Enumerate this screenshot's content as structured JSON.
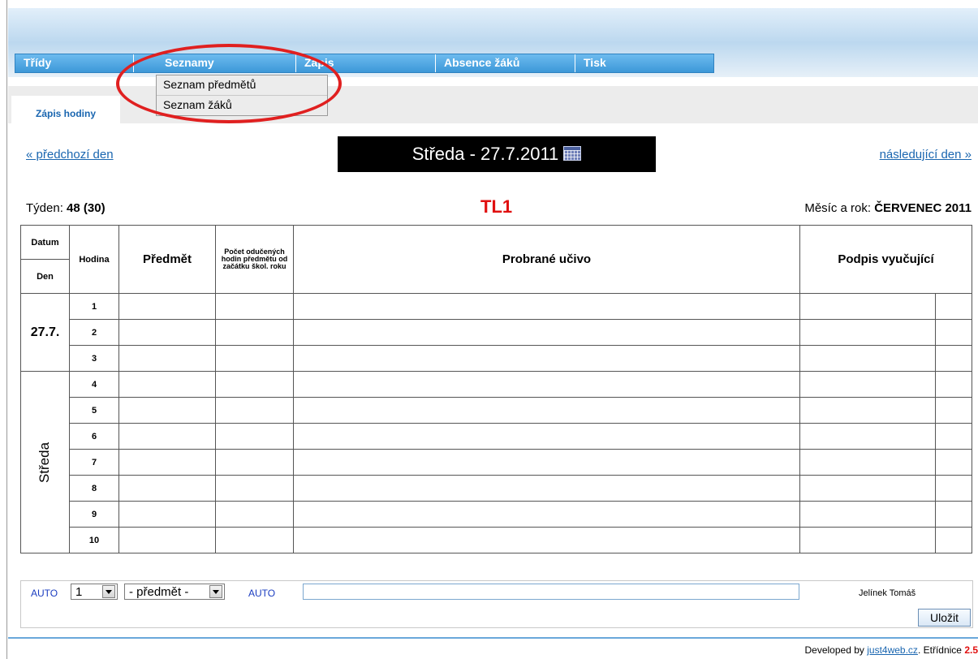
{
  "nav": {
    "items": [
      "Třídy",
      "Seznamy",
      "Zápis",
      "Absence žáků",
      "Tisk"
    ]
  },
  "dropdown": {
    "items": [
      "Seznam předmětů",
      "Seznam žáků"
    ]
  },
  "subtab": {
    "label": "Zápis hodiny"
  },
  "day_nav": {
    "prev": "« předchozí den",
    "next": "následující den »",
    "current": "Středa - 27.7.2011"
  },
  "info": {
    "week_label": "Týden:",
    "week_value": "48 (30)",
    "class_code": "TL1",
    "month_label": "Měsíc a rok:",
    "month_value": "ČERVENEC 2011"
  },
  "table": {
    "headers": {
      "datum": "Datum",
      "den": "Den",
      "hodina": "Hodina",
      "predmet": "Předmět",
      "pocet": "Počet odučených hodin předmětu od začátku škol. roku",
      "ucivo": "Probrané učivo",
      "podpis": "Podpis vyučující"
    },
    "date": "27.7.",
    "day": "Středa",
    "hours": [
      "1",
      "2",
      "3",
      "4",
      "5",
      "6",
      "7",
      "8",
      "9",
      "10"
    ]
  },
  "form": {
    "auto1": "AUTO",
    "hour_select": "1",
    "subject_select": "- předmět -",
    "auto2": "AUTO",
    "teacher": "Jelínek Tomáš",
    "save": "Uložit"
  },
  "footer": {
    "prefix": "Developed by",
    "link": "just4web.cz",
    "suffix": ". Etřídnice",
    "version": "2.5"
  }
}
